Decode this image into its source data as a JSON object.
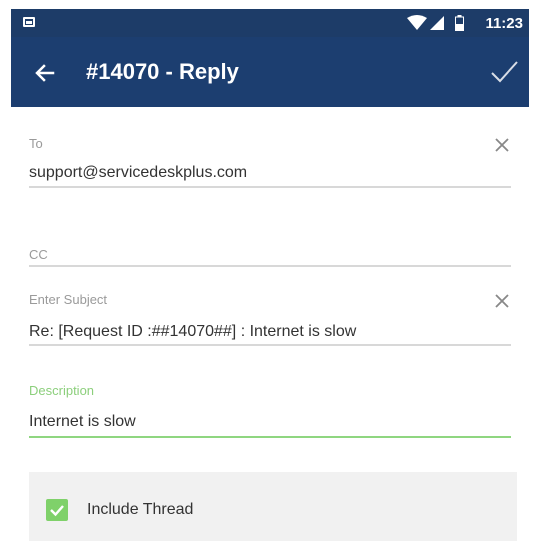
{
  "status_bar": {
    "time": "11:23"
  },
  "header": {
    "title": "#14070 - Reply"
  },
  "form": {
    "to": {
      "label": "To",
      "value": "support@servicedeskplus.com"
    },
    "cc": {
      "label": "CC",
      "value": ""
    },
    "subject": {
      "label": "Enter Subject",
      "value": "Re: [Request ID :##14070##] : Internet is slow"
    },
    "description": {
      "label": "Description",
      "value": "Internet is slow"
    }
  },
  "include_thread": {
    "label": "Include Thread",
    "checked": true
  },
  "colors": {
    "primary": "#1c3e70",
    "accent": "#7fd16a",
    "status_bar": "#1d3c68"
  },
  "icons": {
    "back": "arrow-left-icon",
    "send": "checkmark-icon",
    "clear": "close-icon"
  }
}
